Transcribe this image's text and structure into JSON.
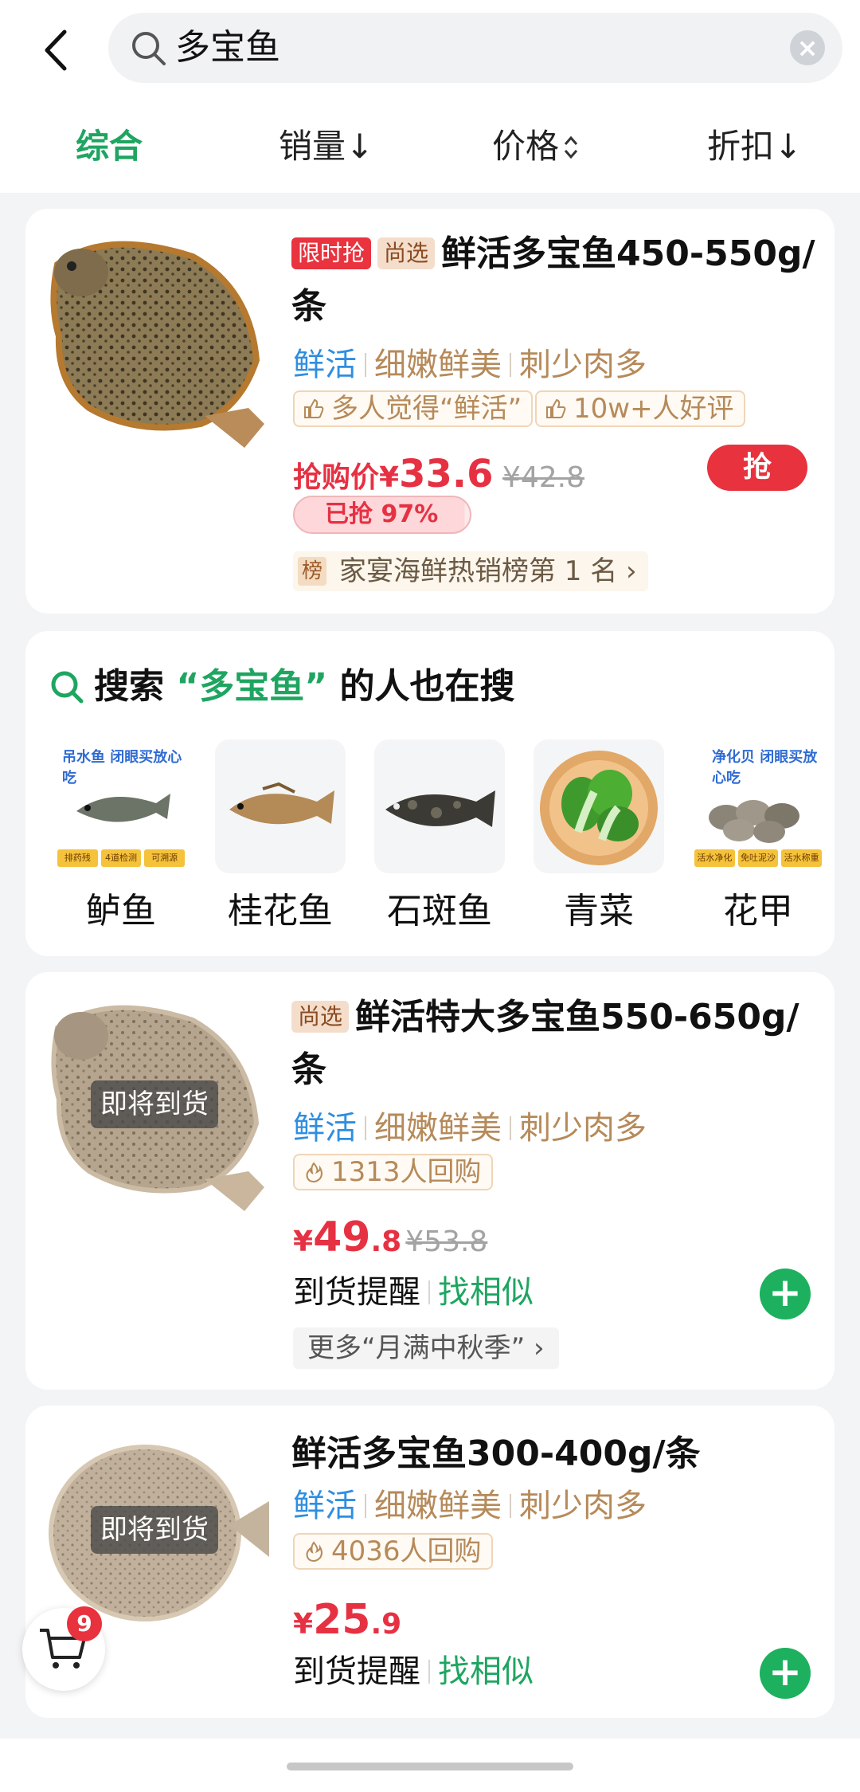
{
  "search": {
    "query": "多宝鱼"
  },
  "sort_tabs": [
    {
      "label": "综合"
    },
    {
      "label": "销量↓"
    },
    {
      "label": "价格"
    },
    {
      "label": "折扣↓"
    }
  ],
  "colors": {
    "accent_green": "#1fa561",
    "price_red": "#e63143",
    "tag_blue": "#2f8ee0"
  },
  "products": [
    {
      "badges": [
        "限时抢",
        "尚选"
      ],
      "title": "鲜活多宝鱼450-550g/条",
      "attrs": [
        "鲜活",
        "细嫩鲜美",
        "刺少肉多"
      ],
      "chips": [
        "多人觉得“鲜活”",
        "10w+人好评"
      ],
      "price_label": "抢购价",
      "currency": "¥",
      "price": "33.6",
      "original_price": "¥42.8",
      "grab_label": "抢",
      "progress_text": "已抢 97%",
      "progress": 0.97,
      "rank_icon": "榜",
      "rank_text": "家宴海鲜热销榜第 1 名",
      "image_icon": "turbot-fish-image"
    },
    {
      "badges": [
        "尚选"
      ],
      "title": "鲜活特大多宝鱼550-650g/条",
      "attrs": [
        "鲜活",
        "细嫩鲜美",
        "刺少肉多"
      ],
      "chips": [
        "1313人回购"
      ],
      "currency": "¥",
      "price_int": "49",
      "price_dec": ".8",
      "original_price": "¥53.8",
      "overlay": "即将到货",
      "remind": "到货提醒",
      "similar": "找相似",
      "more": "更多“月满中秋季”",
      "image_icon": "turbot-fish-image"
    },
    {
      "badges": [],
      "title": "鲜活多宝鱼300-400g/条",
      "attrs": [
        "鲜活",
        "细嫩鲜美",
        "刺少肉多"
      ],
      "chips": [
        "4036人回购"
      ],
      "currency": "¥",
      "price_int": "25",
      "price_dec": ".9",
      "overlay": "即将到货",
      "remind": "到货提醒",
      "similar": "找相似",
      "image_icon": "turbot-fish-image"
    }
  ],
  "related": {
    "prefix": "搜索",
    "keyword": "“多宝鱼”",
    "suffix": "的人也在搜",
    "items": [
      {
        "label": "鲈鱼",
        "promo": "吊水鱼 闭眼买放心吃",
        "tags": [
          "排药残",
          "4道检测",
          "可溯源"
        ]
      },
      {
        "label": "桂花鱼"
      },
      {
        "label": "石斑鱼"
      },
      {
        "label": "青菜"
      },
      {
        "label": "花甲",
        "promo": "净化贝 闭眼买放心吃",
        "tags": [
          "活水净化",
          "免吐泥沙",
          "活水称重"
        ]
      }
    ]
  },
  "cart": {
    "count": "9"
  }
}
